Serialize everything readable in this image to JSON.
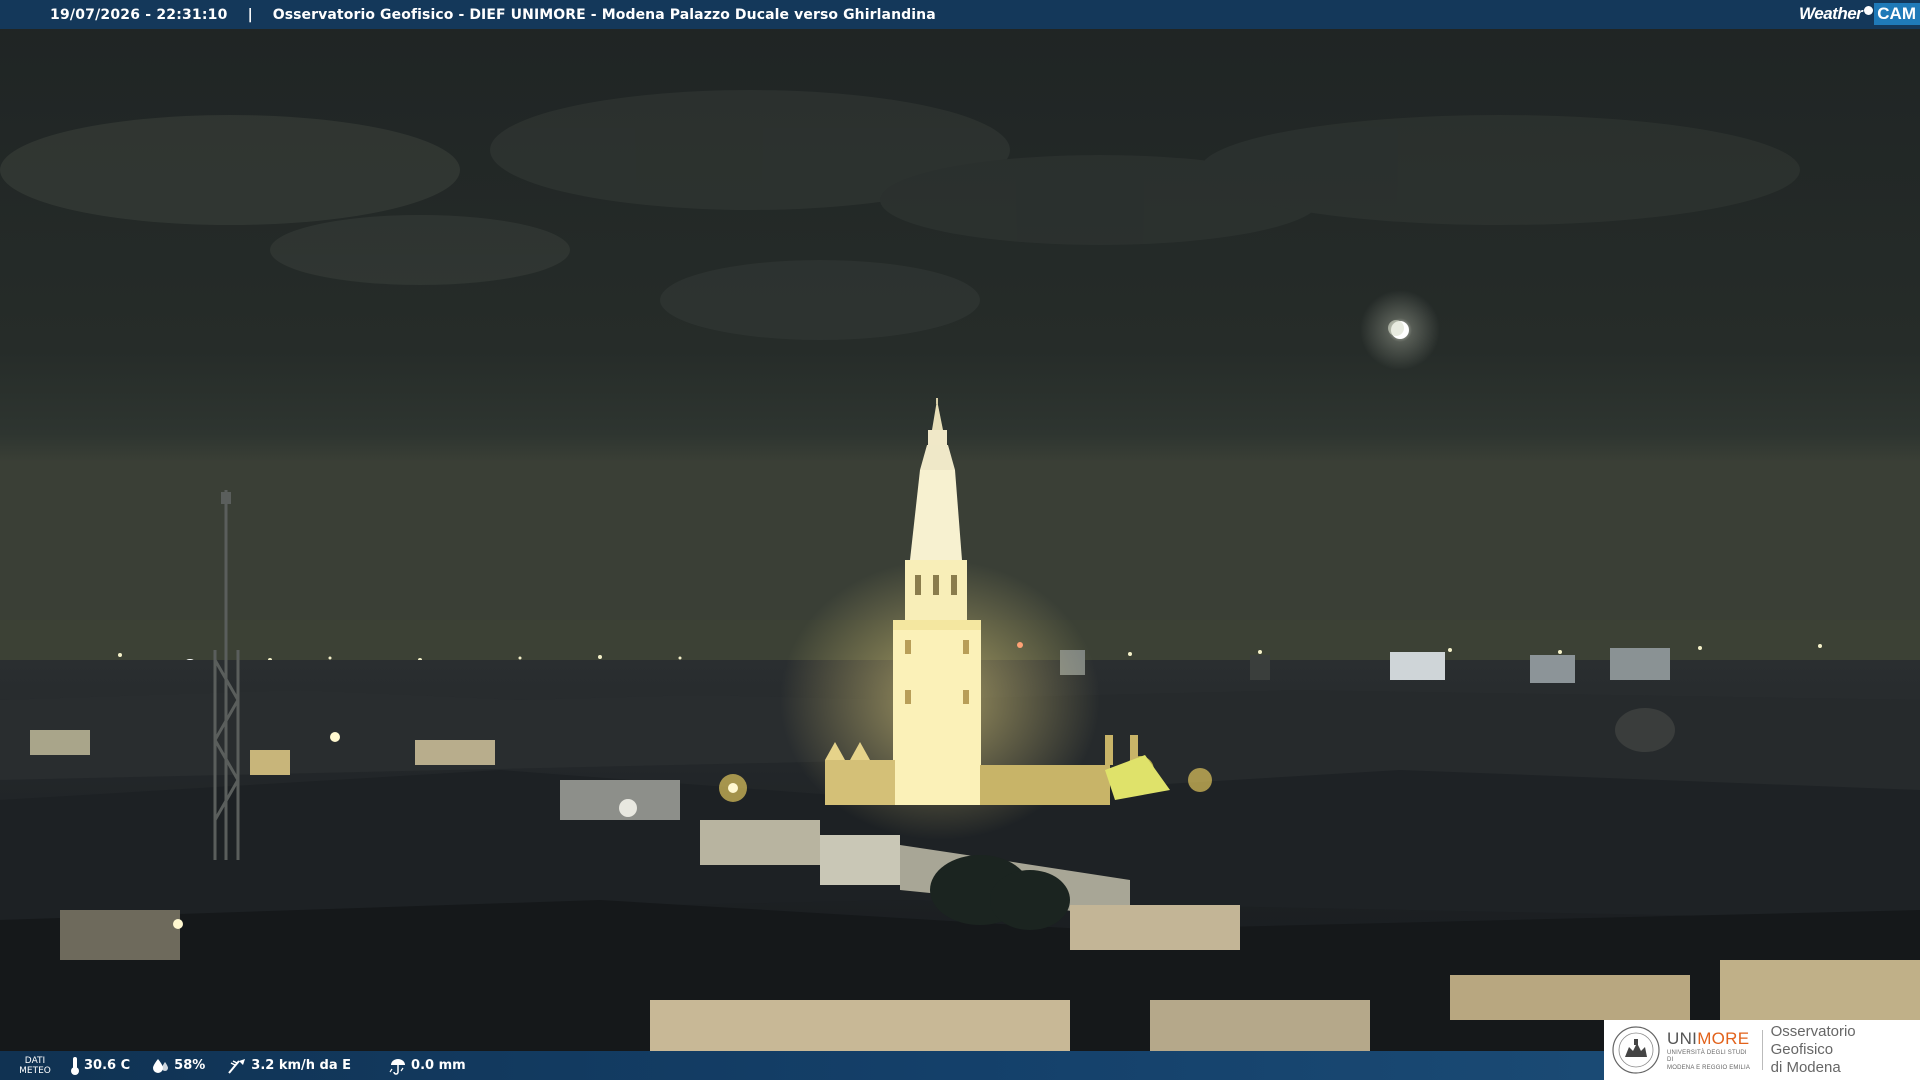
{
  "top_bar": {
    "timestamp": "19/07/2026 - 22:31:10",
    "separator": "|",
    "camera_title": "Osservatorio Geofisico - DIEF UNIMORE - Modena Palazzo Ducale verso Ghirlandina",
    "brand_weather": "Weather",
    "brand_cam": "CAM"
  },
  "meteo_bar": {
    "label_line1": "DATI",
    "label_line2": "METEO",
    "temperature": "30.6 C",
    "humidity": "58%",
    "wind": "3.2 km/h da E",
    "rain": "0.0 mm"
  },
  "logo": {
    "uni_name_part1": "UNI",
    "uni_name_part2": "MORE",
    "uni_sub_line1": "UNIVERSITÀ DEGLI STUDI DI",
    "uni_sub_line2": "MODENA E REGGIO EMILIA",
    "observatory_line1": "Osservatorio Geofisico",
    "observatory_line2": "di Modena"
  },
  "colors": {
    "bar_blue": "#14385a",
    "brand_cam_blue": "#1f7ab8",
    "unimore_orange": "#e2621b",
    "sky": "#232927",
    "tower_light": "#fff6c2"
  },
  "icons": {
    "temperature": "thermometer-icon",
    "humidity": "droplets-icon",
    "wind": "wind-icon",
    "rain": "rain-gauge-icon",
    "seal": "university-seal-icon"
  }
}
